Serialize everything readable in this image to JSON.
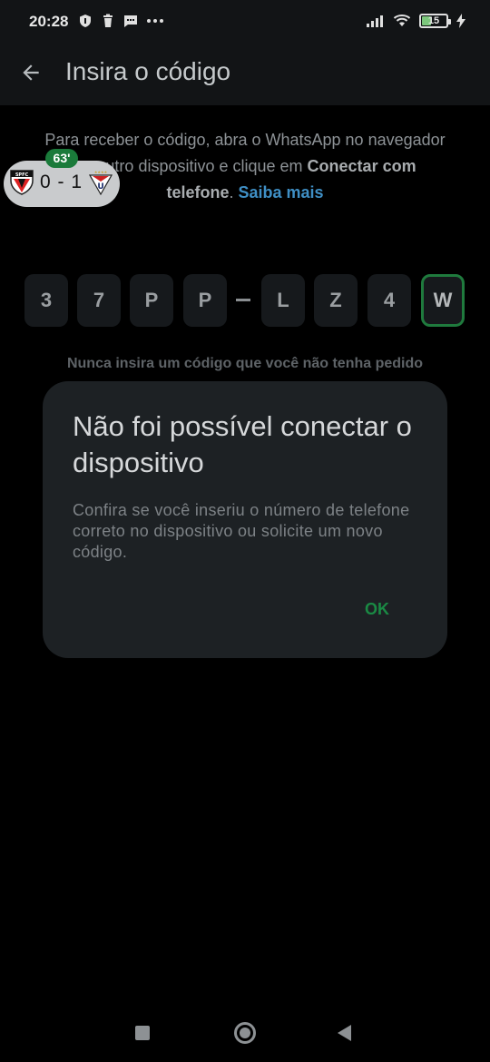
{
  "status_bar": {
    "time": "20:28",
    "battery_level": "15",
    "icons_left": [
      "shield-notification-icon",
      "trash-icon",
      "message-icon",
      "more-dots-icon"
    ],
    "icons_right": [
      "signal-icon",
      "wifi-icon",
      "battery-icon",
      "charging-bolt-icon"
    ]
  },
  "app_bar": {
    "back_icon": "arrow-left-icon",
    "title": "Insira o código"
  },
  "instructions": {
    "text_part1": "Para receber o código, abra o WhatsApp no navegador",
    "text_part2_hidden": "no outro dispositivo e clique em ",
    "bold": "Conectar com",
    "bold2": "telefone",
    "after_bold": ". ",
    "link": "Saiba mais"
  },
  "score_widget": {
    "minute": "63'",
    "score": "0 - 1",
    "home_team_crest": "spfc-crest",
    "home_team_abbr": "SPFC",
    "away_team_crest": "ldu-crest",
    "away_team_abbr": "U"
  },
  "code": {
    "chars": [
      "3",
      "7",
      "P",
      "P",
      "L",
      "Z",
      "4",
      "W"
    ],
    "active_index": 7
  },
  "warning": "Nunca insira um código que você não tenha pedido",
  "dialog": {
    "title": "Não foi possível conectar o dispositivo",
    "body": "Confira se você inseriu o número de telefone correto no dispositivo ou solicite um novo código.",
    "ok_label": "OK"
  },
  "colors": {
    "accent_green": "#1a8a44",
    "link_blue": "#3f8fc5",
    "dialog_bg": "#1d2124"
  }
}
